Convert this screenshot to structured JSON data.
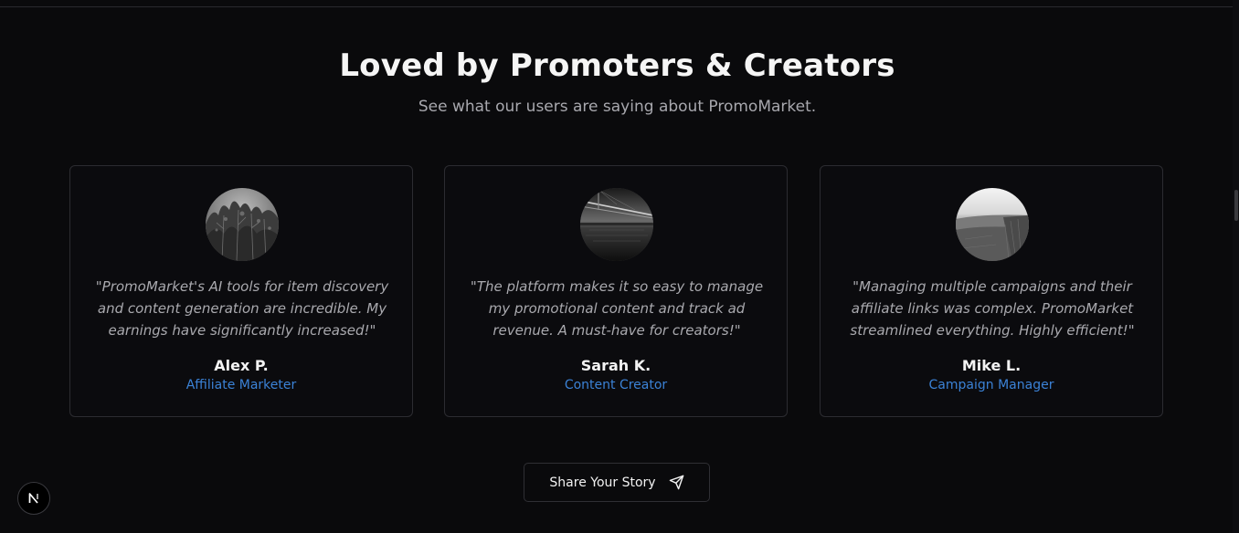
{
  "section": {
    "title": "Loved by Promoters & Creators",
    "subtitle": "See what our users are saying about PromoMarket."
  },
  "testimonials": [
    {
      "quote": "\"PromoMarket's AI tools for item discovery and content generation are incredible. My earnings have significantly increased!\"",
      "name": "Alex P.",
      "role": "Affiliate Marketer",
      "avatar_icon": "trees-photo"
    },
    {
      "quote": "\"The platform makes it so easy to manage my promotional content and track ad revenue. A must-have for creators!\"",
      "name": "Sarah K.",
      "role": "Content Creator",
      "avatar_icon": "bridge-photo"
    },
    {
      "quote": "\"Managing multiple campaigns and their affiliate links was complex. PromoMarket streamlined everything. Highly efficient!\"",
      "name": "Mike L.",
      "role": "Campaign Manager",
      "avatar_icon": "landscape-photo"
    }
  ],
  "cta": {
    "label": "Share Your Story",
    "icon": "send-icon"
  },
  "badge": {
    "label": "N"
  },
  "colors": {
    "background": "#0a0a0c",
    "card_border": "#2c2c31",
    "accent": "#3b82d6",
    "muted_text": "#a9a9ae"
  }
}
